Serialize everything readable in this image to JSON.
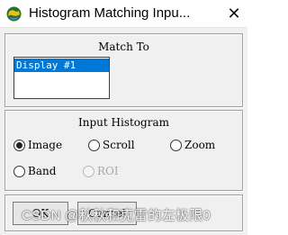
{
  "window": {
    "title": "Histogram Matching Inpu...",
    "close_symbol": "✕",
    "icon": "envi-globe-icon"
  },
  "match_to": {
    "label": "Match To",
    "items": [
      "Display #1"
    ],
    "selected": "Display #1"
  },
  "input_histogram": {
    "label": "Input Histogram",
    "options": [
      {
        "label": "Image",
        "selected": true,
        "enabled": true
      },
      {
        "label": "Scroll",
        "selected": false,
        "enabled": true
      },
      {
        "label": "Zoom",
        "selected": false,
        "enabled": true
      },
      {
        "label": "Band",
        "selected": false,
        "enabled": true
      },
      {
        "label": "ROI",
        "selected": false,
        "enabled": false
      }
    ]
  },
  "buttons": {
    "ok": "OK",
    "cancel": "Cancel"
  },
  "watermark": "CSDN @秋秋和克雷的左极限0",
  "colors": {
    "selection": "#0078d7",
    "dialog_bg": "#f0f0f0"
  }
}
